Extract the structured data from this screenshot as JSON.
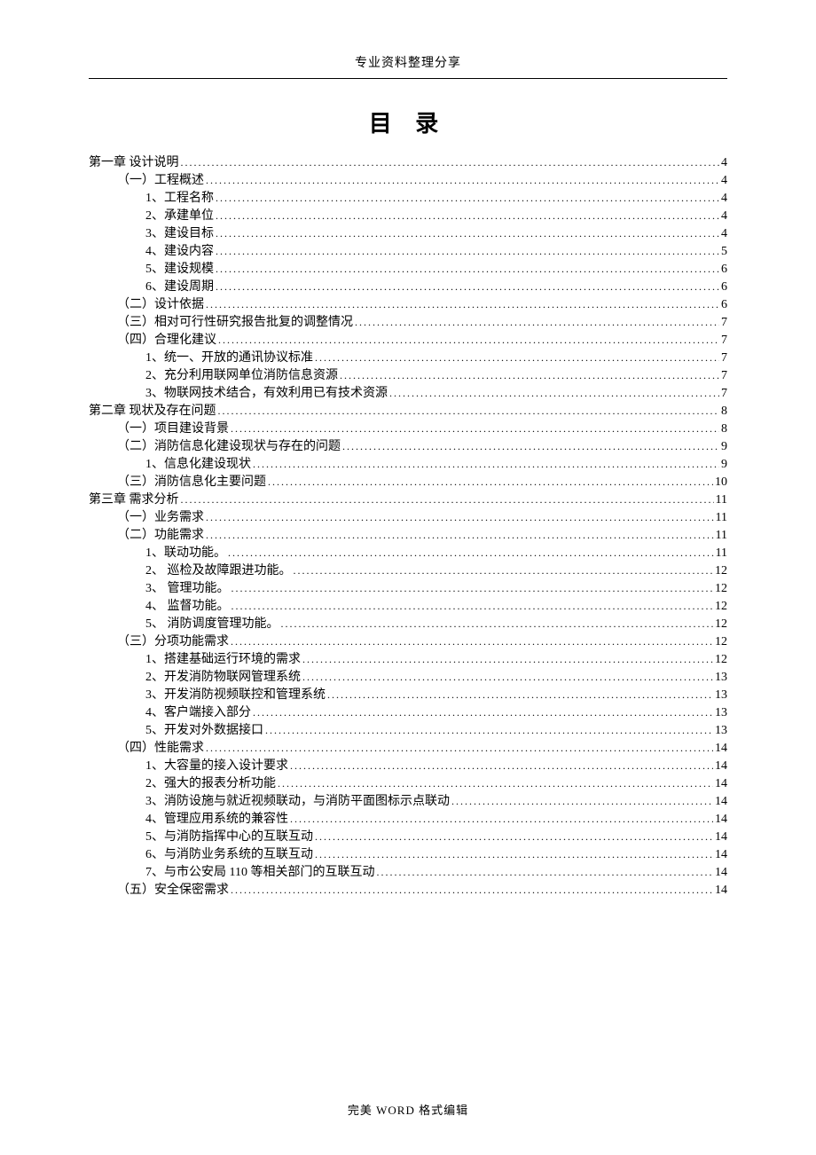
{
  "header": "专业资料整理分享",
  "title": "目 录",
  "footer": "完美 WORD 格式编辑",
  "toc": [
    {
      "level": 0,
      "text": "第一章  设计说明 ",
      "page": "4"
    },
    {
      "level": 1,
      "text": "（一）工程概述",
      "page": "4"
    },
    {
      "level": 2,
      "text": "1、工程名称",
      "page": "4"
    },
    {
      "level": 2,
      "text": "2、承建单位",
      "page": "4"
    },
    {
      "level": 2,
      "text": "3、建设目标",
      "page": "4"
    },
    {
      "level": 2,
      "text": "4、建设内容",
      "page": "5"
    },
    {
      "level": 2,
      "text": "5、建设规模",
      "page": "6"
    },
    {
      "level": 2,
      "text": "6、建设周期",
      "page": "6"
    },
    {
      "level": 1,
      "text": "（二）设计依据",
      "page": "6"
    },
    {
      "level": 1,
      "text": "（三）相对可行性研究报告批复的调整情况 ",
      "page": "7"
    },
    {
      "level": 1,
      "text": "（四）合理化建议",
      "page": "7"
    },
    {
      "level": 2,
      "text": "1、统一、开放的通讯协议标准 ",
      "page": "7"
    },
    {
      "level": 2,
      "text": "2、充分利用联网单位消防信息资源 ",
      "page": "7"
    },
    {
      "level": 2,
      "text": "3、物联网技术结合，有效利用已有技术资源 ",
      "page": "7"
    },
    {
      "level": 0,
      "text": "第二章  现状及存在问题",
      "page": "8"
    },
    {
      "level": 1,
      "text": "（一）项目建设背景",
      "page": "8"
    },
    {
      "level": 1,
      "text": "（二）消防信息化建设现状与存在的问题 ",
      "page": "9"
    },
    {
      "level": 2,
      "text": "1、信息化建设现状",
      "page": "9"
    },
    {
      "level": 1,
      "text": "（三）消防信息化主要问题",
      "page": "10"
    },
    {
      "level": 0,
      "text": "第三章  需求分析 ",
      "page": "11"
    },
    {
      "level": 1,
      "text": "（一）业务需求 ",
      "page": "11"
    },
    {
      "level": 1,
      "text": "（二）功能需求 ",
      "page": "11"
    },
    {
      "level": 2,
      "text": "1、联动功能。",
      "page": "11"
    },
    {
      "level": 2,
      "text": "2、  巡检及故障跟进功能。",
      "page": "12"
    },
    {
      "level": 2,
      "text": "3、  管理功能。",
      "page": "12"
    },
    {
      "level": 2,
      "text": "4、  监督功能。",
      "page": "12"
    },
    {
      "level": 2,
      "text": "5、  消防调度管理功能。",
      "page": "12"
    },
    {
      "level": 1,
      "text": "（三）分项功能需求",
      "page": "12"
    },
    {
      "level": 2,
      "text": "1、搭建基础运行环境的需求",
      "page": "12"
    },
    {
      "level": 2,
      "text": "2、开发消防物联网管理系统",
      "page": "13"
    },
    {
      "level": 2,
      "text": "3、开发消防视频联控和管理系统",
      "page": "13"
    },
    {
      "level": 2,
      "text": "4、客户端接入部分",
      "page": "13"
    },
    {
      "level": 2,
      "text": "5、开发对外数据接口",
      "page": "13"
    },
    {
      "level": 1,
      "text": "（四）性能需求 ",
      "page": "14"
    },
    {
      "level": 2,
      "text": "1、大容量的接入设计要求",
      "page": "14"
    },
    {
      "level": 2,
      "text": "2、强大的报表分析功能",
      "page": "14"
    },
    {
      "level": 2,
      "text": "3、消防设施与就近视频联动，与消防平面图标示点联动 ",
      "page": "14"
    },
    {
      "level": 2,
      "text": "4、管理应用系统的兼容性",
      "page": "14"
    },
    {
      "level": 2,
      "text": "5、与消防指挥中心的互联互动",
      "page": "14"
    },
    {
      "level": 2,
      "text": "6、与消防业务系统的互联互动",
      "page": "14"
    },
    {
      "level": 2,
      "text": "7、与市公安局 110 等相关部门的互联互动 ",
      "page": "14"
    },
    {
      "level": 1,
      "text": "（五）安全保密需求",
      "page": "14"
    }
  ]
}
